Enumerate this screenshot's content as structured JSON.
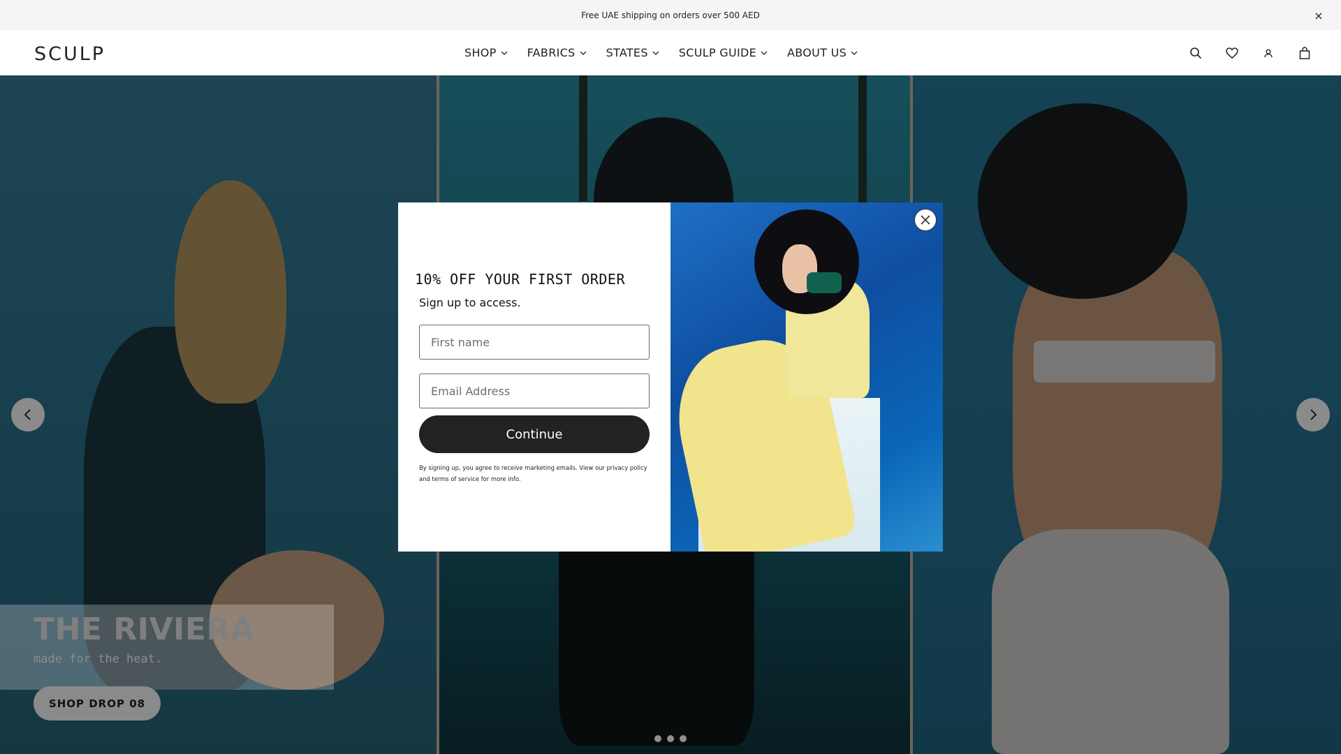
{
  "announcement": {
    "text": "Free UAE shipping on orders over 500 AED",
    "close_glyph": "×"
  },
  "header": {
    "logo": "SCULP",
    "nav": [
      {
        "label": "SHOP"
      },
      {
        "label": "FABRICS"
      },
      {
        "label": "STATES"
      },
      {
        "label": "SCULP GUIDE"
      },
      {
        "label": "ABOUT US"
      }
    ],
    "icons": [
      "search-icon",
      "heart-icon",
      "account-icon",
      "bag-icon"
    ]
  },
  "hero": {
    "title": "THE RIVIERA",
    "subtitle": "made for the heat.",
    "cta": "SHOP DROP 08",
    "slides_count": 3,
    "active_slide": 1
  },
  "modal": {
    "title": "10% OFF YOUR FIRST ORDER",
    "subtitle": "Sign up to access.",
    "first_name_placeholder": "First name",
    "email_placeholder": "Email Address",
    "continue_label": "Continue",
    "legal": "By signing up, you agree to receive marketing emails. View our privacy policy and terms of service for more info."
  },
  "colors": {
    "overlay": "#000000",
    "button_dark": "#242121",
    "modal_image_bg": "#0e4ea0"
  }
}
